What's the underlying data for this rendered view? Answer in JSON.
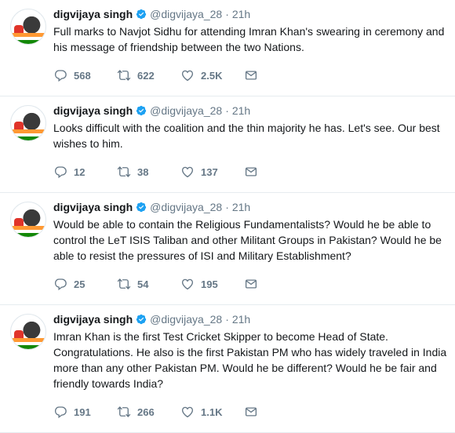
{
  "tweets": [
    {
      "name": "digvijaya singh",
      "handle": "@digvijaya_28",
      "dot": "·",
      "time": "21h",
      "text": "Full marks to Navjot Sidhu for attending Imran Khan's swearing in ceremony and his message of friendship between the two Nations.",
      "replies": "568",
      "retweets": "622",
      "likes": "2.5K"
    },
    {
      "name": "digvijaya singh",
      "handle": "@digvijaya_28",
      "dot": "·",
      "time": "21h",
      "text": "Looks difficult with the coalition and the thin majority he has. Let's see. Our best wishes to him.",
      "replies": "12",
      "retweets": "38",
      "likes": "137"
    },
    {
      "name": "digvijaya singh",
      "handle": "@digvijaya_28",
      "dot": "·",
      "time": "21h",
      "text": "Would be able to contain the Religious Fundamentalists? Would he be able to control the LeT ISIS Taliban and other Militant Groups in Pakistan? Would he be able to resist the pressures of ISI and Military Establishment?",
      "replies": "25",
      "retweets": "54",
      "likes": "195"
    },
    {
      "name": "digvijaya singh",
      "handle": "@digvijaya_28",
      "dot": "·",
      "time": "21h",
      "text": "Imran Khan is the first Test Cricket Skipper to become Head of State. Congratulations. He also is the first Pakistan PM who has widely traveled in India more than any other Pakistan  PM. Would he be different? Would he be fair and friendly towards India?",
      "replies": "191",
      "retweets": "266",
      "likes": "1.1K"
    }
  ],
  "colors": {
    "verified": "#1da1f2",
    "muted": "#657786",
    "divider": "#e6ecf0"
  },
  "icons": [
    "reply-icon",
    "retweet-icon",
    "like-icon",
    "direct-message-icon",
    "verified-badge-icon"
  ]
}
